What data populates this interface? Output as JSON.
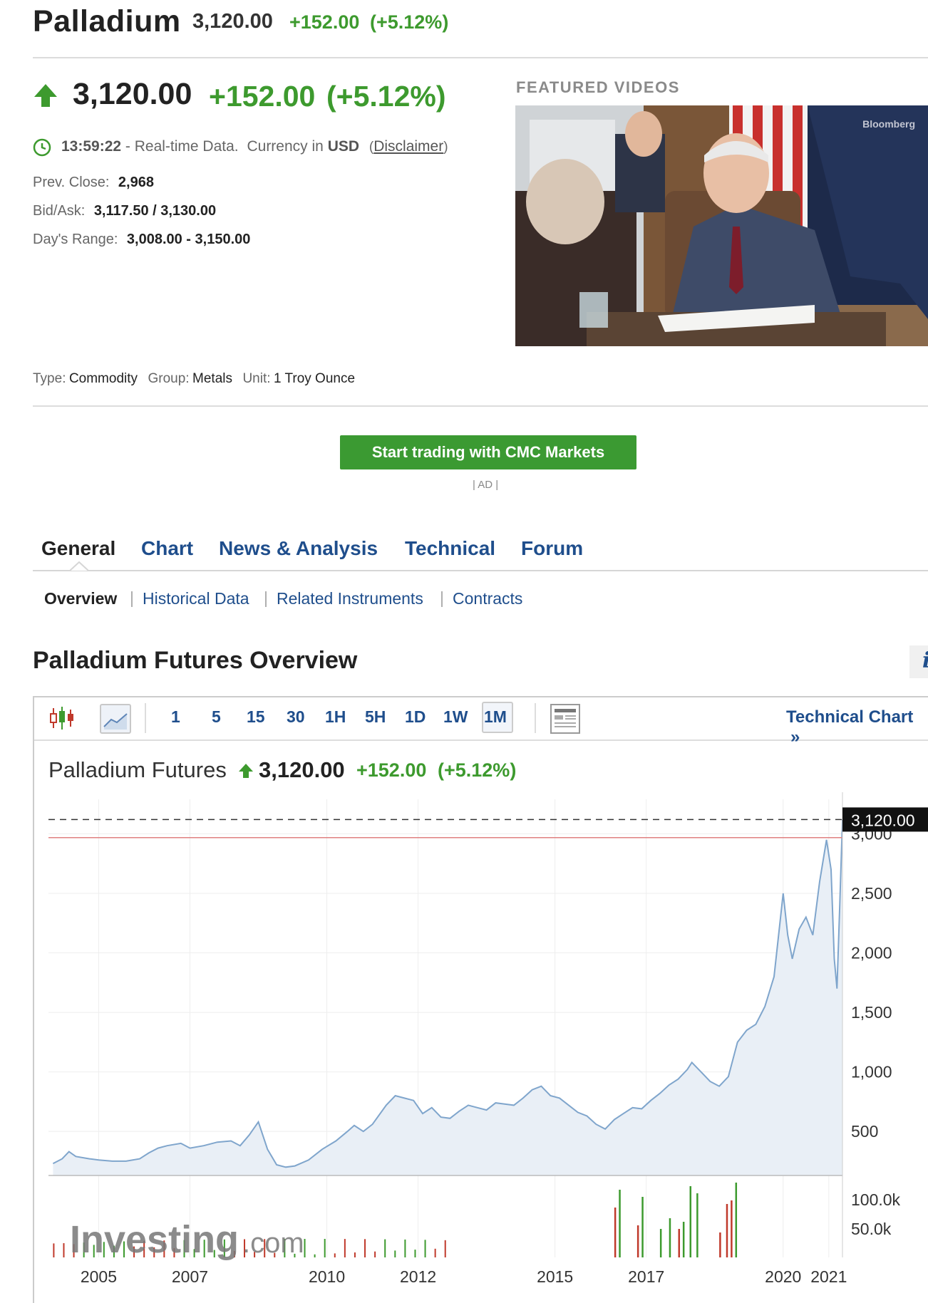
{
  "header": {
    "title": "Palladium",
    "price": "3,120.00",
    "change": "+152.00",
    "change_pct": "(+5.12%)"
  },
  "quote": {
    "price": "3,120.00",
    "change": "+152.00",
    "change_pct": "(+5.12%)",
    "time": "13:59:22",
    "realtime_label": "- Real-time Data.",
    "currency_label": "Currency in",
    "currency": "USD",
    "disclaimer_open": "(",
    "disclaimer": "Disclaimer",
    "disclaimer_close": ")",
    "stats": [
      {
        "label": "Prev. Close:",
        "value": "2,968"
      },
      {
        "label": "Bid/Ask:",
        "value": "3,117.50 / 3,130.00"
      },
      {
        "label": "Day's Range:",
        "value": "3,008.00 - 3,150.00"
      }
    ],
    "type_label": "Type:",
    "type_value": "Commodity",
    "group_label": "Group:",
    "group_value": "Metals",
    "unit_label": "Unit:",
    "unit_value": "1 Troy Ounce"
  },
  "featured": {
    "heading": "FEATURED VIDEOS",
    "watermark": "Bloomberg"
  },
  "ad": {
    "button": "Start trading with CMC Markets",
    "label": "| AD |"
  },
  "tabs": [
    {
      "label": "General",
      "active": true
    },
    {
      "label": "Chart",
      "active": false
    },
    {
      "label": "News & Analysis",
      "active": false
    },
    {
      "label": "Technical",
      "active": false
    },
    {
      "label": "Forum",
      "active": false
    }
  ],
  "subtabs": [
    {
      "label": "Overview",
      "active": true
    },
    {
      "label": "Historical Data",
      "active": false
    },
    {
      "label": "Related Instruments",
      "active": false
    },
    {
      "label": "Contracts",
      "active": false
    }
  ],
  "overview_title": "Palladium Futures Overview",
  "toolbar": {
    "timeframes": [
      "1",
      "5",
      "15",
      "30",
      "1H",
      "5H",
      "1D",
      "1W",
      "1M"
    ],
    "active": "1M",
    "technical_chart": "Technical Chart"
  },
  "chart_header": {
    "name": "Palladium Futures",
    "price": "3,120.00",
    "change": "+152.00",
    "change_pct": "(+5.12%)"
  },
  "chart_data": {
    "type": "area",
    "title": "Palladium Futures",
    "line_color": "#7fa5cc",
    "fill_color": "#e9eff6",
    "last_price_label": "3,120.00",
    "last_price": 3120,
    "prev_close": 2968,
    "ylim": [
      130,
      3230
    ],
    "y_ticks": [
      500,
      1000,
      1500,
      2000,
      2500,
      3000
    ],
    "y_tick_labels": [
      "500",
      "1,000",
      "1,500",
      "2,000",
      "2,500",
      "3,000"
    ],
    "x_ticks": [
      2005,
      2007,
      2010,
      2012,
      2015,
      2017,
      2020,
      2021
    ],
    "x_tick_labels": [
      "2005",
      "2007",
      "2010",
      "2012",
      "2015",
      "2017",
      "2020",
      "2021"
    ],
    "xlim": [
      2003.9,
      2021.3
    ],
    "series": [
      {
        "values": [
          [
            2004.0,
            230
          ],
          [
            2004.2,
            270
          ],
          [
            2004.35,
            330
          ],
          [
            2004.5,
            290
          ],
          [
            2004.8,
            270
          ],
          [
            2005.0,
            260
          ],
          [
            2005.3,
            250
          ],
          [
            2005.6,
            250
          ],
          [
            2005.9,
            270
          ],
          [
            2006.1,
            320
          ],
          [
            2006.3,
            360
          ],
          [
            2006.5,
            380
          ],
          [
            2006.8,
            400
          ],
          [
            2007.0,
            360
          ],
          [
            2007.3,
            380
          ],
          [
            2007.6,
            410
          ],
          [
            2007.9,
            420
          ],
          [
            2008.1,
            380
          ],
          [
            2008.3,
            470
          ],
          [
            2008.5,
            580
          ],
          [
            2008.7,
            350
          ],
          [
            2008.9,
            220
          ],
          [
            2009.1,
            200
          ],
          [
            2009.3,
            210
          ],
          [
            2009.6,
            260
          ],
          [
            2009.9,
            350
          ],
          [
            2010.2,
            420
          ],
          [
            2010.45,
            500
          ],
          [
            2010.6,
            550
          ],
          [
            2010.8,
            500
          ],
          [
            2011.0,
            560
          ],
          [
            2011.3,
            720
          ],
          [
            2011.5,
            800
          ],
          [
            2011.7,
            780
          ],
          [
            2011.9,
            760
          ],
          [
            2012.1,
            650
          ],
          [
            2012.3,
            700
          ],
          [
            2012.5,
            620
          ],
          [
            2012.7,
            610
          ],
          [
            2012.9,
            670
          ],
          [
            2013.1,
            720
          ],
          [
            2013.3,
            700
          ],
          [
            2013.5,
            680
          ],
          [
            2013.7,
            740
          ],
          [
            2013.9,
            730
          ],
          [
            2014.1,
            720
          ],
          [
            2014.3,
            780
          ],
          [
            2014.5,
            850
          ],
          [
            2014.7,
            880
          ],
          [
            2014.9,
            800
          ],
          [
            2015.1,
            780
          ],
          [
            2015.3,
            720
          ],
          [
            2015.5,
            660
          ],
          [
            2015.7,
            630
          ],
          [
            2015.9,
            560
          ],
          [
            2016.1,
            520
          ],
          [
            2016.3,
            600
          ],
          [
            2016.5,
            650
          ],
          [
            2016.7,
            700
          ],
          [
            2016.9,
            690
          ],
          [
            2017.1,
            760
          ],
          [
            2017.3,
            820
          ],
          [
            2017.5,
            890
          ],
          [
            2017.7,
            940
          ],
          [
            2017.9,
            1020
          ],
          [
            2018.0,
            1080
          ],
          [
            2018.2,
            1000
          ],
          [
            2018.4,
            920
          ],
          [
            2018.6,
            880
          ],
          [
            2018.8,
            960
          ],
          [
            2019.0,
            1250
          ],
          [
            2019.2,
            1350
          ],
          [
            2019.4,
            1400
          ],
          [
            2019.6,
            1550
          ],
          [
            2019.8,
            1800
          ],
          [
            2020.0,
            2500
          ],
          [
            2020.1,
            2150
          ],
          [
            2020.2,
            1950
          ],
          [
            2020.35,
            2200
          ],
          [
            2020.5,
            2300
          ],
          [
            2020.65,
            2150
          ],
          [
            2020.8,
            2600
          ],
          [
            2020.95,
            2950
          ],
          [
            2021.05,
            2700
          ],
          [
            2021.12,
            1950
          ],
          [
            2021.18,
            1700
          ],
          [
            2021.24,
            2400
          ],
          [
            2021.3,
            3120
          ]
        ]
      }
    ],
    "volume_ticks": [
      "100.0k",
      "50.0k"
    ],
    "watermark_big": "Investing",
    "watermark_small": ".com"
  }
}
